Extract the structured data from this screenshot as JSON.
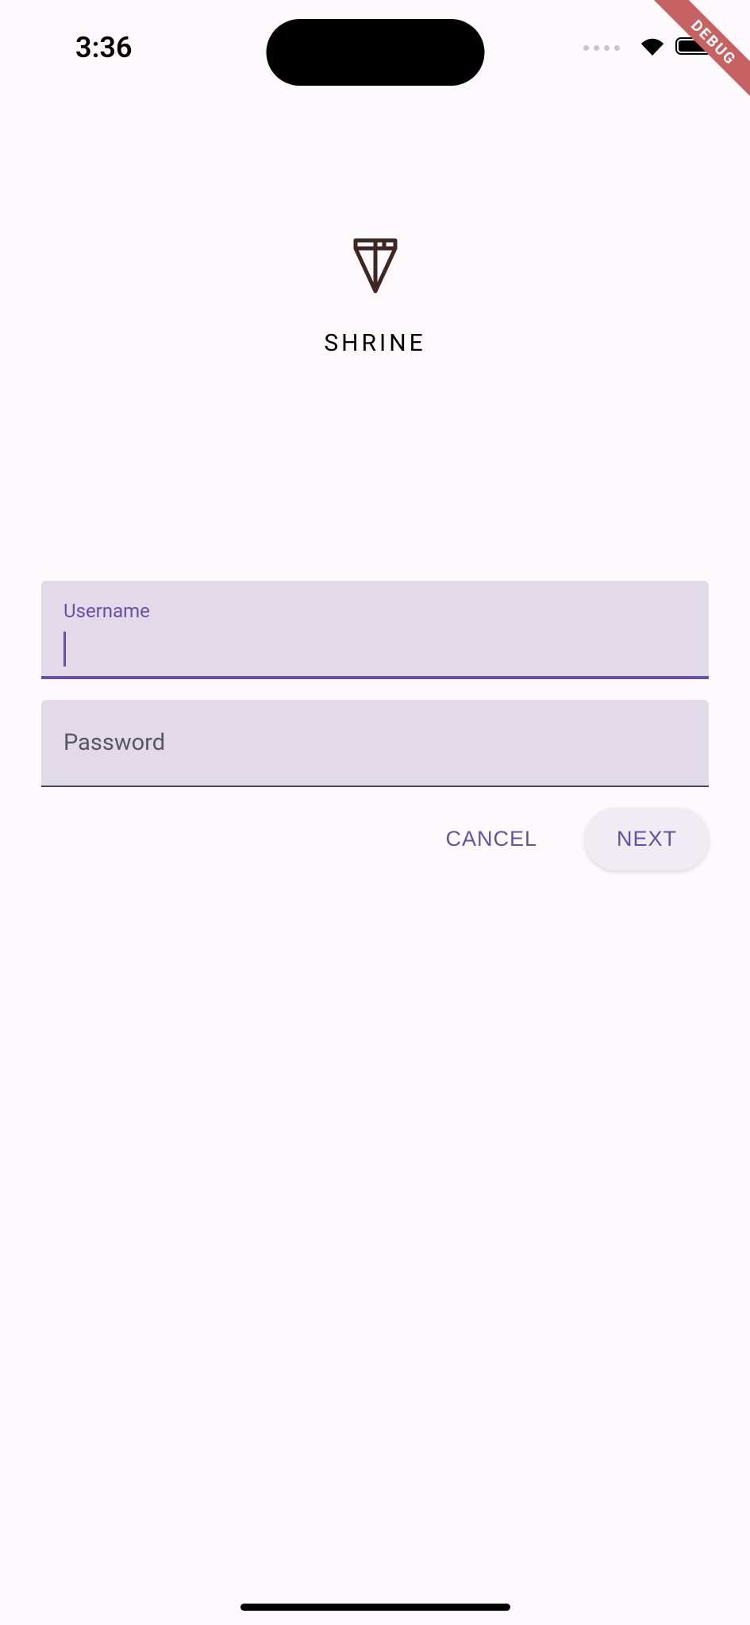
{
  "status": {
    "time": "3:36"
  },
  "debug_label": "DEBUG",
  "logo": {
    "app_name": "SHRINE"
  },
  "form": {
    "username": {
      "label": "Username",
      "value": ""
    },
    "password": {
      "label": "Password",
      "value": ""
    }
  },
  "buttons": {
    "cancel": "CANCEL",
    "next": "NEXT"
  }
}
